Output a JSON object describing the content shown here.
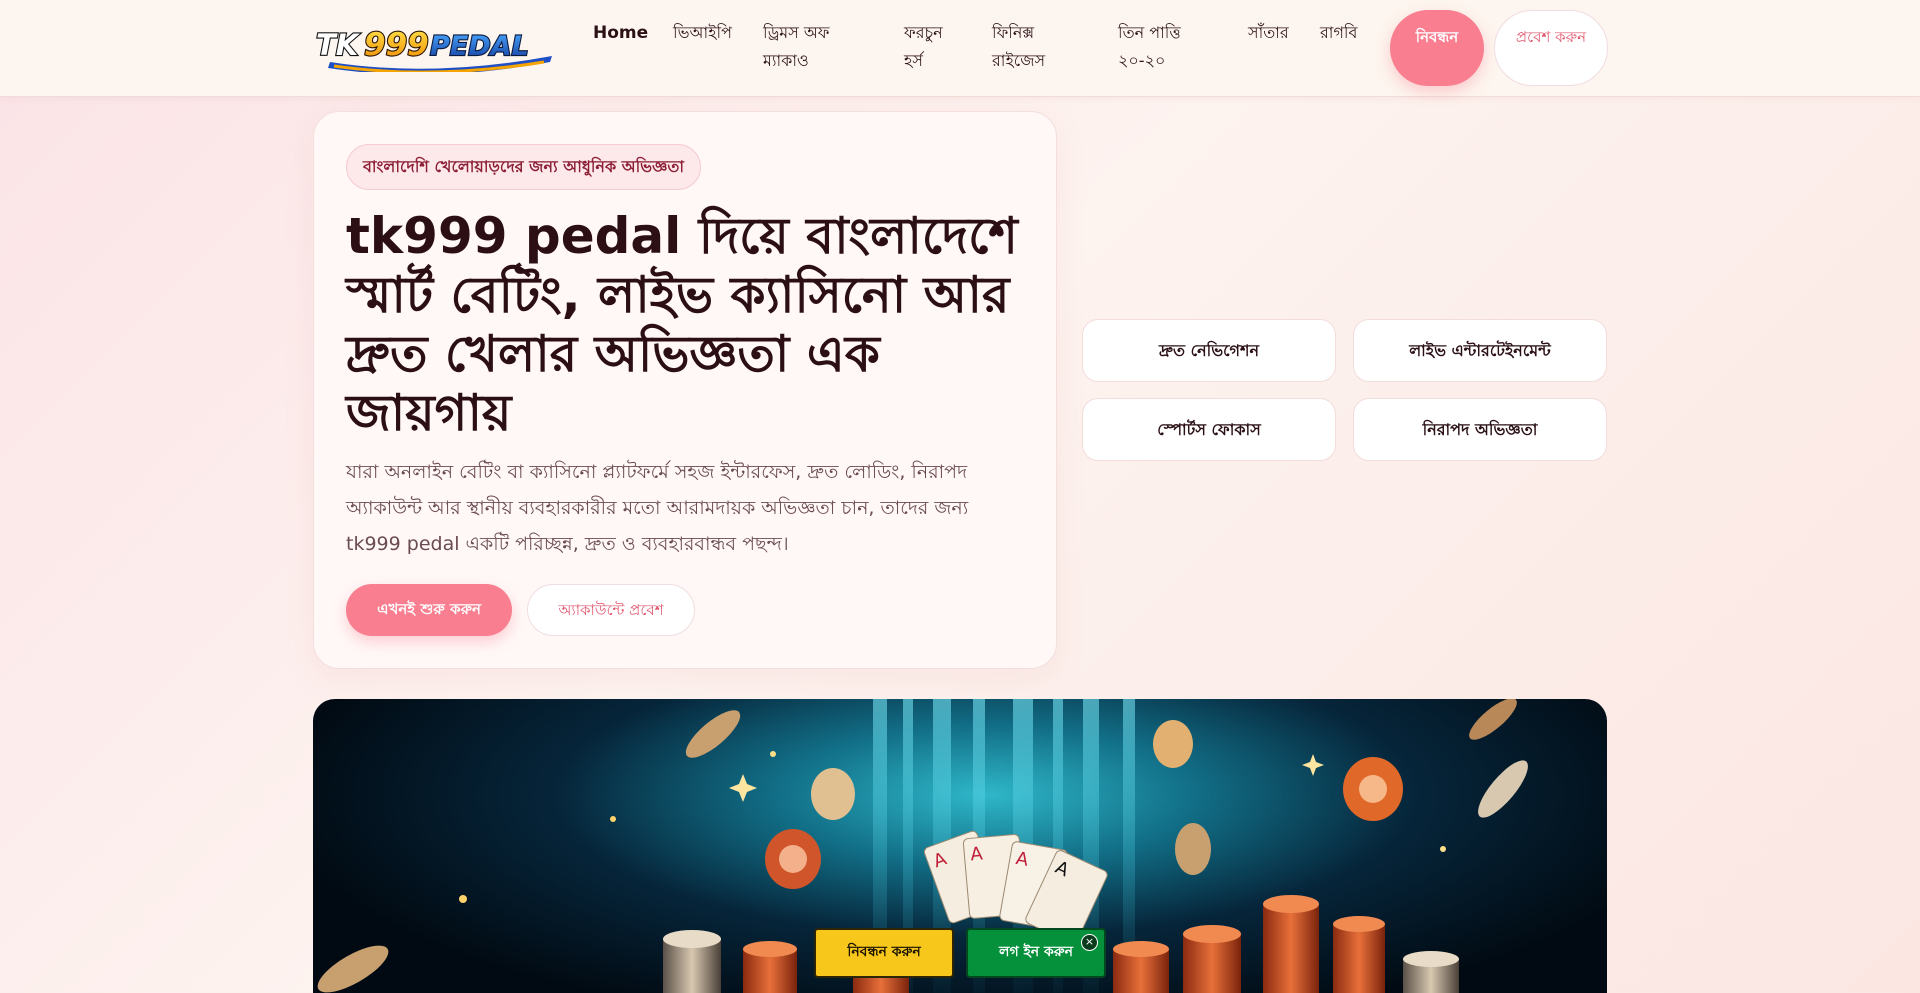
{
  "header": {
    "logo_text": "TK999PEDAL",
    "nav": [
      {
        "label": "Home"
      },
      {
        "label": "ভিআইপি"
      },
      {
        "label": "ড্রিমস অফ ম্যাকাও"
      },
      {
        "label": "ফরচুন হর্স"
      },
      {
        "label": "ফিনিক্স রাইজেস"
      },
      {
        "label": "তিন পাত্তি ২০-২০"
      },
      {
        "label": "সাঁতার"
      },
      {
        "label": "রাগবি"
      }
    ],
    "register_label": "নিবন্ধন",
    "login_label": "প্রবেশ করুন"
  },
  "hero": {
    "badge": "বাংলাদেশি খেলোয়াড়দের জন্য আধুনিক অভিজ্ঞতা",
    "title": "tk999 pedal দিয়ে বাংলাদেশে স্মার্ট বেটিং, লাইভ ক্যাসিনো আর দ্রুত খেলার অভিজ্ঞতা এক জায়গায়",
    "description": "যারা অনলাইন বেটিং বা ক্যাসিনো প্ল্যাটফর্মে সহজ ইন্টারফেস, দ্রুত লোডিং, নিরাপদ অ্যাকাউন্ট আর স্থানীয় ব্যবহারকারীর মতো আরামদায়ক অভিজ্ঞতা চান, তাদের জন্য tk999 pedal একটি পরিচ্ছন্ন, দ্রুত ও ব্যবহারবান্ধব পছন্দ।",
    "primary_button": "এখনই শুরু করুন",
    "secondary_button": "অ্যাকাউন্টে প্রবেশ"
  },
  "features": [
    {
      "label": "দ্রুত নেভিগেশন"
    },
    {
      "label": "লাইভ এন্টারটেইনমেন্ট"
    },
    {
      "label": "স্পোর্টস ফোকাস"
    },
    {
      "label": "নিরাপদ অভিজ্ঞতা"
    }
  ],
  "sticky": {
    "register_label": "নিবন্ধন করুন",
    "login_label": "লগ ইন করুন",
    "close_label": "×"
  },
  "colors": {
    "accent": "#f87e90",
    "register_sticky": "#f7c71c",
    "login_sticky": "#05913c"
  }
}
